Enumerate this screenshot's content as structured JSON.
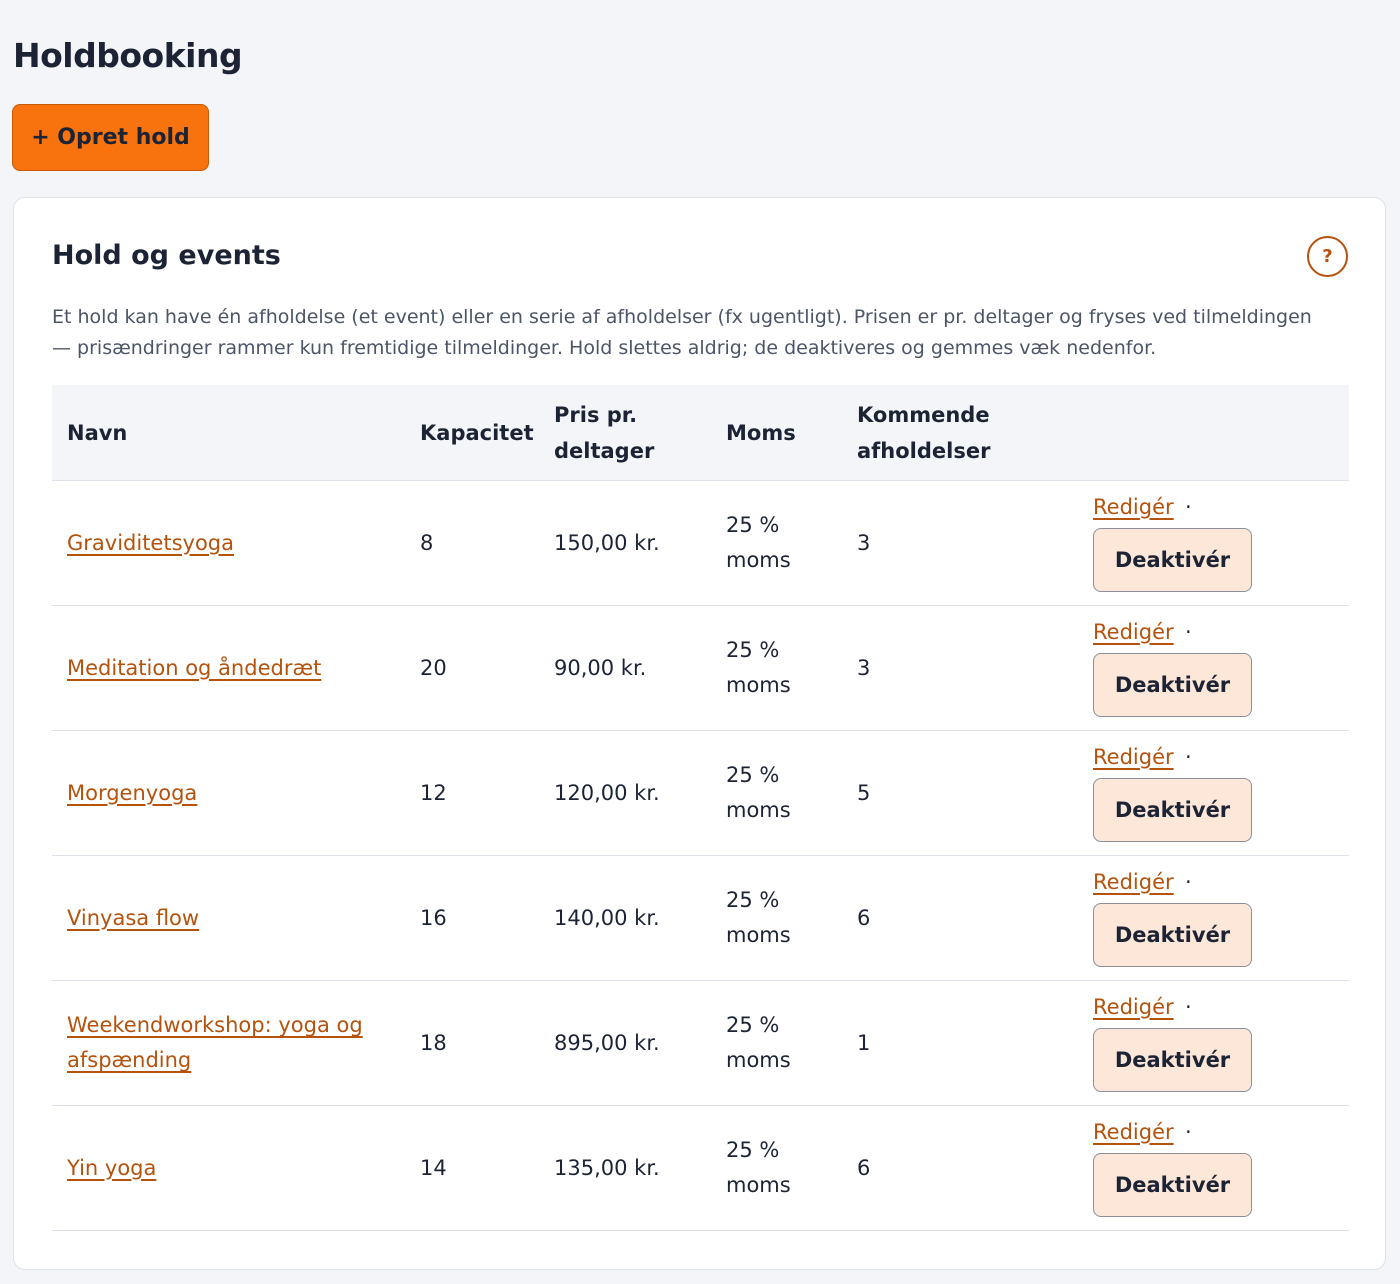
{
  "page": {
    "title": "Holdbooking",
    "create_label": "+ Opret hold"
  },
  "card": {
    "title": "Hold og events",
    "help_label": "?",
    "description": "Et hold kan have én afholdelse (et event) eller en serie af afholdelser (fx ugentligt). Prisen er pr. deltager og fryses ved tilmeldingen — prisændringer rammer kun fremtidige tilmeldinger. Hold slettes aldrig; de deaktiveres og gemmes væk nedenfor."
  },
  "table": {
    "headers": {
      "name": "Navn",
      "capacity": "Kapacitet",
      "price": "Pris pr. deltager",
      "vat": "Moms",
      "upcoming": "Kommende afholdelser"
    },
    "edit_label": "Redigér",
    "separator": "·",
    "deactivate_label": "Deaktivér",
    "rows": [
      {
        "name": "Graviditetsyoga",
        "capacity": "8",
        "price": "150,00 kr.",
        "vat": "25 % moms",
        "upcoming": "3"
      },
      {
        "name": "Meditation og åndedræt",
        "capacity": "20",
        "price": "90,00 kr.",
        "vat": "25 % moms",
        "upcoming": "3"
      },
      {
        "name": "Morgenyoga",
        "capacity": "12",
        "price": "120,00 kr.",
        "vat": "25 % moms",
        "upcoming": "5"
      },
      {
        "name": "Vinyasa flow",
        "capacity": "16",
        "price": "140,00 kr.",
        "vat": "25 % moms",
        "upcoming": "6"
      },
      {
        "name": "Weekendworkshop: yoga og afspænding",
        "capacity": "18",
        "price": "895,00 kr.",
        "vat": "25 % moms",
        "upcoming": "1"
      },
      {
        "name": "Yin yoga",
        "capacity": "14",
        "price": "135,00 kr.",
        "vat": "25 % moms",
        "upcoming": "6"
      }
    ]
  }
}
